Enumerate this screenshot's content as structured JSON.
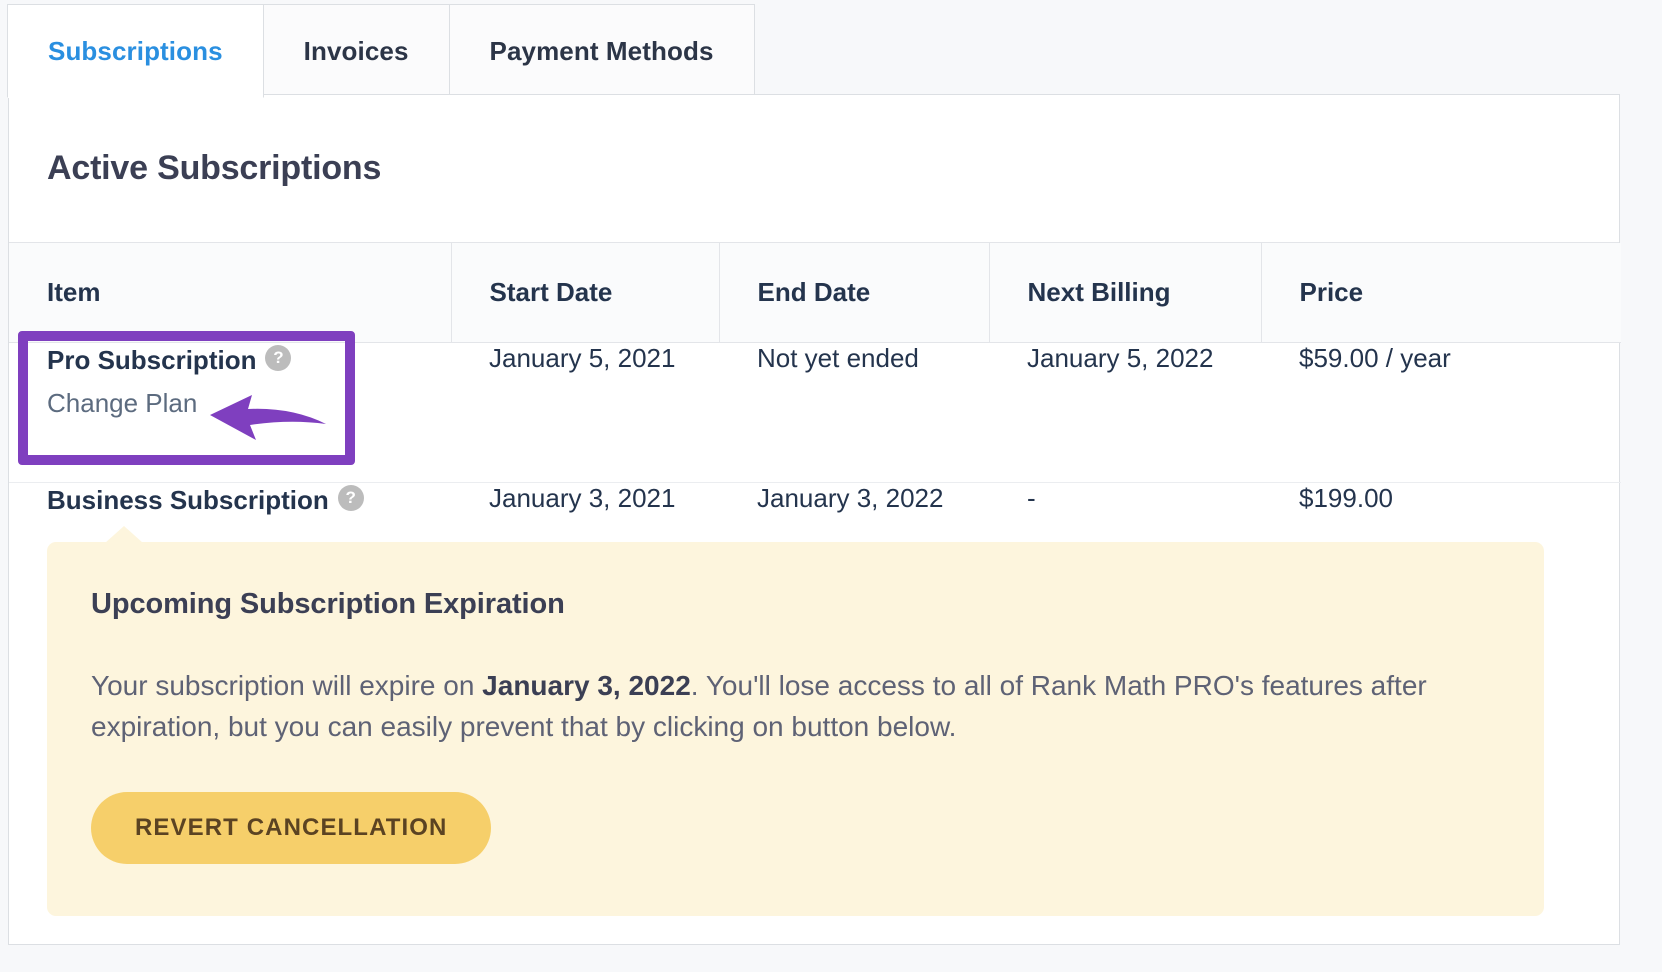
{
  "tabs": [
    {
      "label": "Subscriptions",
      "active": true
    },
    {
      "label": "Invoices",
      "active": false
    },
    {
      "label": "Payment Methods",
      "active": false
    }
  ],
  "card": {
    "heading": "Active Subscriptions"
  },
  "table": {
    "headers": {
      "item": "Item",
      "start_date": "Start Date",
      "end_date": "End Date",
      "next_billing": "Next Billing",
      "price": "Price"
    },
    "rows": [
      {
        "item": "Pro Subscription",
        "help_icon": "?",
        "action_label": "Change Plan",
        "start_date": "January 5, 2021",
        "end_date": "Not yet ended",
        "next_billing": "January 5, 2022",
        "price": "$59.00 / year"
      },
      {
        "item": "Business Subscription",
        "help_icon": "?",
        "start_date": "January 3, 2021",
        "end_date": "January 3, 2022",
        "next_billing": "-",
        "price": "$199.00"
      }
    ]
  },
  "notice": {
    "title": "Upcoming Subscription Expiration",
    "body_before": "Your subscription will expire on ",
    "body_bold": "January 3, 2022",
    "body_after": ". You'll lose access to all of Rank Math PRO's features after expiration, but you can easily prevent that by clicking on button below.",
    "button_label": "REVERT CANCELLATION"
  },
  "annotation": {
    "color": "#7f3fbf",
    "arrow_icon": "left-arrow-icon",
    "highlight_icon": "highlight-box"
  },
  "colors": {
    "accent_tab": "#2a8fe0",
    "notice_bg": "#fdf5dd",
    "button_bg": "#f6cf6a",
    "annotation_purple": "#7f3fbf",
    "text_dark": "#24344d"
  }
}
